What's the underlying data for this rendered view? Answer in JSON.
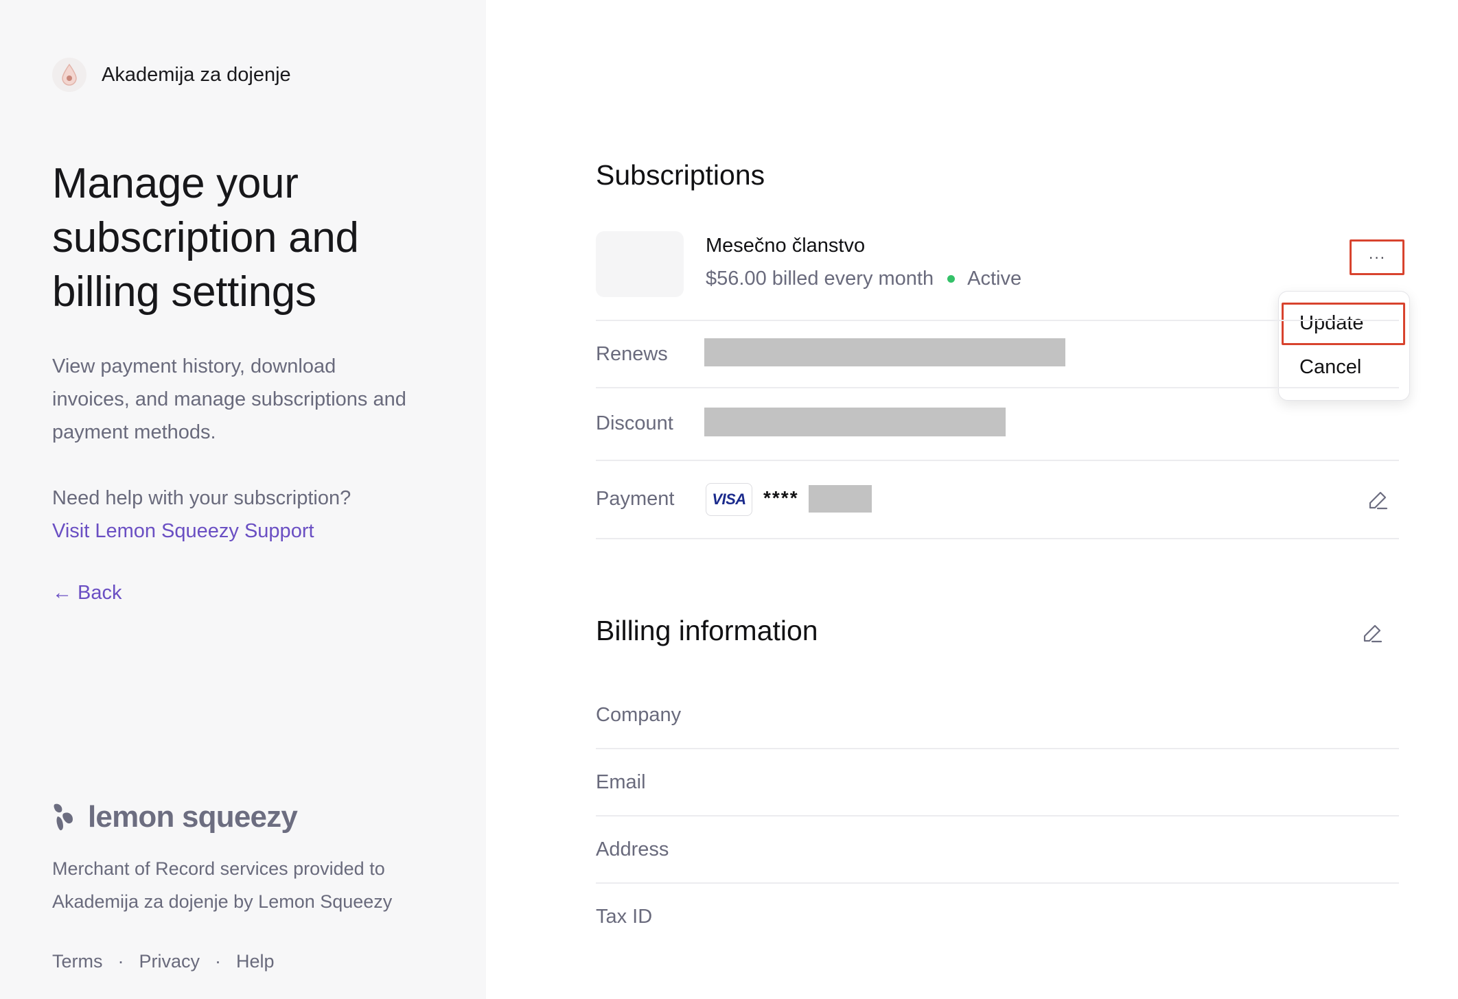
{
  "brand": {
    "name": "Akademija za dojenje",
    "logo_icon": "drop-logo-icon"
  },
  "headline": "Manage your subscription and billing settings",
  "intro": "View payment history, download invoices, and manage subscriptions and payment methods.",
  "help": {
    "question": "Need help with your subscription?",
    "link_label": "Visit Lemon Squeezy Support"
  },
  "back": {
    "arrow": "←",
    "label": "Back"
  },
  "footer": {
    "wordmark": "lemon squeezy",
    "merchant": "Merchant of Record services provided to Akademija za dojenje by Lemon Squeezy",
    "links": [
      "Terms",
      "Privacy",
      "Help"
    ],
    "separator": "·"
  },
  "subscriptions": {
    "title": "Subscriptions",
    "item": {
      "name": "Mesečno članstvo",
      "price_text": "$56.00 billed every month",
      "status": "Active",
      "status_color": "#34c168"
    },
    "more_button": "···",
    "menu": {
      "items": [
        "Update",
        "Cancel"
      ]
    },
    "rows": {
      "renews_label": "Renews",
      "discount_label": "Discount",
      "payment_label": "Payment",
      "card_brand": "VISA",
      "card_masked": "****"
    }
  },
  "billing": {
    "title": "Billing information",
    "fields": [
      "Company",
      "Email",
      "Address",
      "Tax ID"
    ]
  },
  "colors": {
    "accent": "#6a4fc3",
    "highlight": "#d8432e",
    "muted_text": "#696a7c",
    "redaction": "#c2c2c2"
  }
}
